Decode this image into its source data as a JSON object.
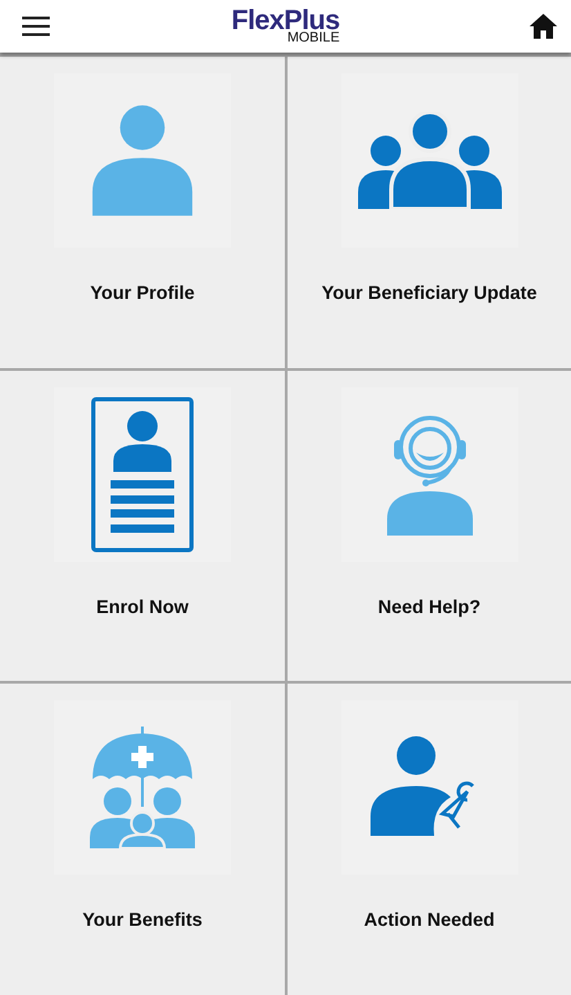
{
  "header": {
    "logo_main": "FlexPlus",
    "logo_sub": "MOBILE"
  },
  "tiles": [
    {
      "label": "Your Profile"
    },
    {
      "label": "Your Beneficiary Update"
    },
    {
      "label": "Enrol Now"
    },
    {
      "label": "Need Help?"
    },
    {
      "label": "Your Benefits"
    },
    {
      "label": "Action Needed"
    }
  ]
}
